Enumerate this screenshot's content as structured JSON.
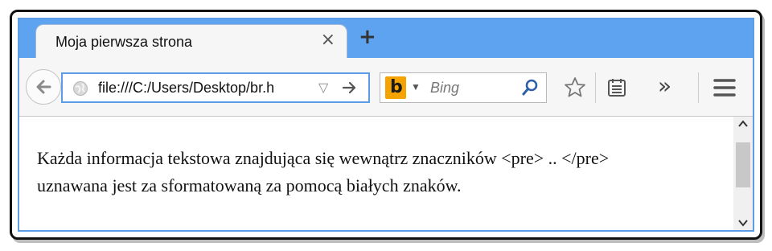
{
  "tab": {
    "title": "Moja pierwsza strona",
    "close_symbol": "×",
    "new_tab_symbol": "+"
  },
  "navbar": {
    "url": "file:///C:/Users/Desktop/br.h",
    "search_engine": "bing",
    "search_placeholder": "Bing",
    "overflow_symbol": "»"
  },
  "content": {
    "lines": [
      "Każda informacja tekstowa znajdująca się wewnątrz znaczników <pre> .. </pre>",
      "uznawana jest za sformatowaną za pomocą białych znaków."
    ]
  },
  "scrollbar": {
    "up_symbol": "^",
    "down_symbol": "v"
  },
  "colors": {
    "tabbar": "#5ea3f0",
    "urlbar_border": "#5c9be6",
    "bing_logo": "#f5a300"
  }
}
